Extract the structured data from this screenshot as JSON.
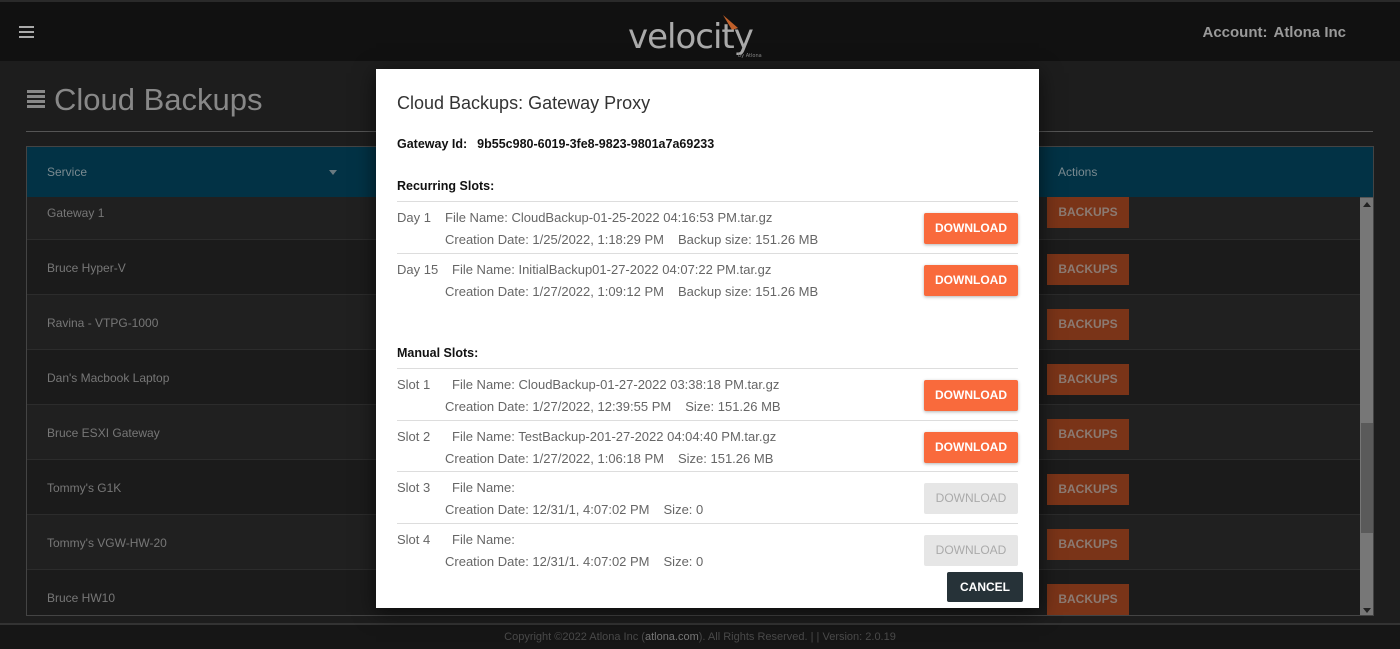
{
  "header": {
    "logo_text": "velocity",
    "logo_sub": "by Atlona",
    "account_label": "Account:",
    "account_name": "Atlona Inc"
  },
  "page": {
    "title": "Cloud Backups"
  },
  "table": {
    "columns": [
      "Service",
      "Actions"
    ],
    "rows": [
      {
        "service": "Gateway 1",
        "action": "BACKUPS"
      },
      {
        "service": "Bruce Hyper-V",
        "action": "BACKUPS"
      },
      {
        "service": "Ravina - VTPG-1000",
        "action": "BACKUPS"
      },
      {
        "service": "Dan's Macbook Laptop",
        "action": "BACKUPS"
      },
      {
        "service": "Bruce ESXI Gateway",
        "action": "BACKUPS"
      },
      {
        "service": "Tommy's G1K",
        "action": "BACKUPS"
      },
      {
        "service": "Tommy's VGW-HW-20",
        "action": "BACKUPS"
      },
      {
        "service": "Bruce HW10",
        "action": "BACKUPS"
      }
    ]
  },
  "modal": {
    "title": "Cloud Backups: Gateway Proxy",
    "gateway_label": "Gateway Id:",
    "gateway_id": "9b55c980-6019-3fe8-9823-9801a7a69233",
    "recurring_label": "Recurring Slots:",
    "manual_label": "Manual Slots:",
    "recurring": [
      {
        "label": "Day 1",
        "file": "File Name: CloudBackup-01-25-2022 04:16:53 PM.tar.gz",
        "date": "Creation Date: 1/25/2022, 1:18:29 PM",
        "size": "Backup size: 151.26 MB",
        "button": "DOWNLOAD",
        "enabled": true
      },
      {
        "label": "Day 15",
        "file": "File Name: InitialBackup01-27-2022 04:07:22 PM.tar.gz",
        "date": "Creation Date: 1/27/2022, 1:09:12 PM",
        "size": "Backup size: 151.26 MB",
        "button": "DOWNLOAD",
        "enabled": true
      }
    ],
    "manual": [
      {
        "label": "Slot 1",
        "file": "File Name: CloudBackup-01-27-2022 03:38:18 PM.tar.gz",
        "date": "Creation Date: 1/27/2022, 12:39:55 PM",
        "size": "Size: 151.26 MB",
        "button": "DOWNLOAD",
        "enabled": true
      },
      {
        "label": "Slot 2",
        "file": "File Name: TestBackup-201-27-2022 04:04:40 PM.tar.gz",
        "date": "Creation Date: 1/27/2022, 1:06:18 PM",
        "size": "Size: 151.26 MB",
        "button": "DOWNLOAD",
        "enabled": true
      },
      {
        "label": "Slot 3",
        "file": "File Name:",
        "date": "Creation Date: 12/31/1, 4:07:02 PM",
        "size": "Size: 0",
        "button": "DOWNLOAD",
        "enabled": false
      },
      {
        "label": "Slot 4",
        "file": "File Name:",
        "date": "Creation Date: 12/31/1. 4:07:02 PM",
        "size": "Size: 0",
        "button": "DOWNLOAD",
        "enabled": false
      }
    ],
    "cancel": "CANCEL"
  },
  "footer": {
    "pre": "Copyright ©2022 Atlona Inc (",
    "link": "atlona.com",
    "post": "). All Rights Reserved. | | Version: 2.0.19"
  },
  "colors": {
    "accent": "#f96a3c",
    "header": "#023245",
    "cancel": "#263238"
  }
}
